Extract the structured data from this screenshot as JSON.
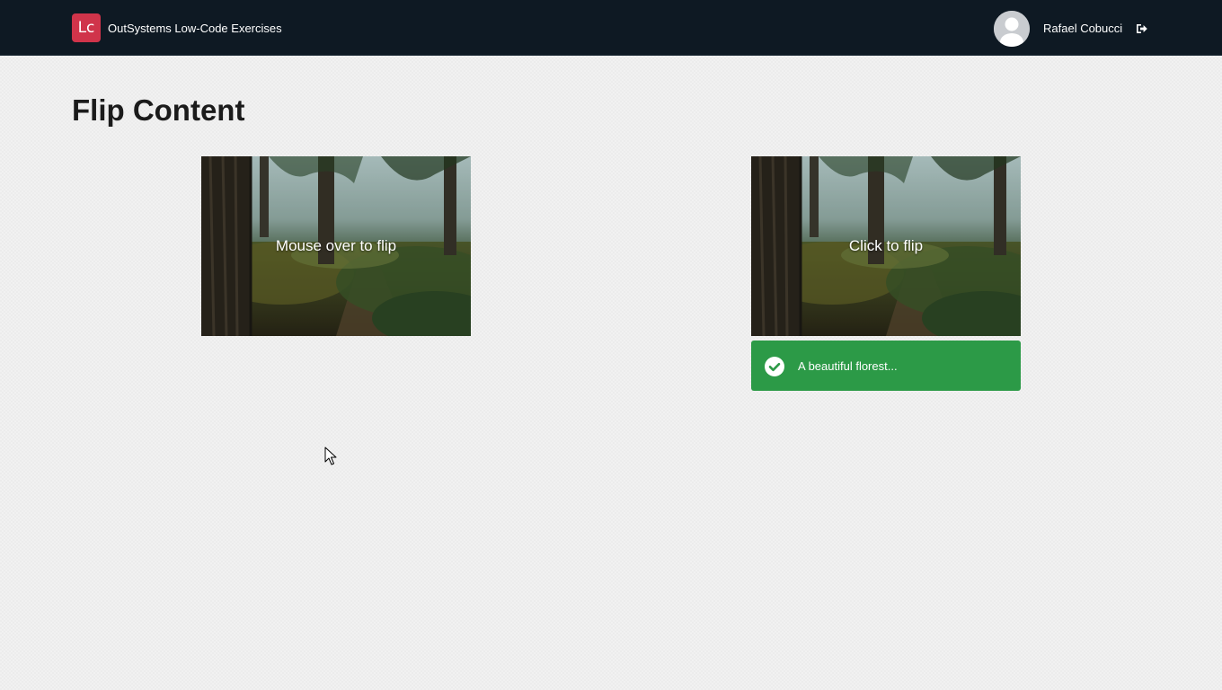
{
  "header": {
    "logo_text": "Lc",
    "app_title": "OutSystems Low-Code Exercises",
    "user_name": "Rafael Cobucci",
    "brand_color": "#d0344a",
    "background_color": "#0e1923",
    "icons": {
      "avatar": "user-avatar-icon",
      "logout": "sign-out-icon"
    }
  },
  "main": {
    "title": "Flip Content",
    "cards": [
      {
        "caption": "Mouse over to flip",
        "image": "forest-photo"
      },
      {
        "caption": "Click to flip",
        "image": "forest-photo"
      }
    ],
    "alert": {
      "text": "A beautiful florest...",
      "icon": "check-circle-icon",
      "color": "#2c9a47"
    }
  }
}
